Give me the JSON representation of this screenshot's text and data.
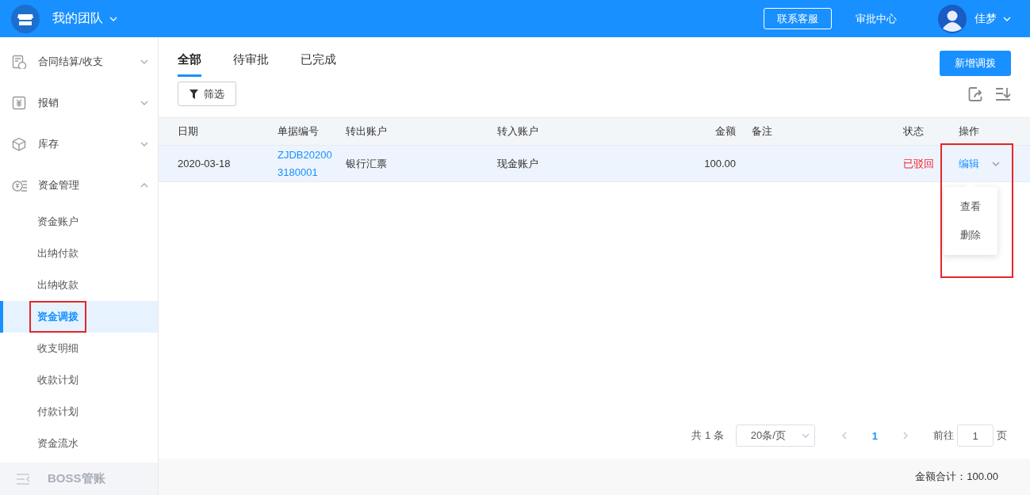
{
  "header": {
    "team": "我的团队",
    "service_button": "联系客服",
    "approval_link": "审批中心",
    "user": "佳梦"
  },
  "sidebar": {
    "items": [
      {
        "label": "合同结算/收支",
        "expanded": false
      },
      {
        "label": "报销",
        "expanded": false
      },
      {
        "label": "库存",
        "expanded": false
      },
      {
        "label": "资金管理",
        "expanded": true,
        "children": [
          {
            "label": "资金账户",
            "selected": false,
            "highlighted": false
          },
          {
            "label": "出纳付款",
            "selected": false,
            "highlighted": false
          },
          {
            "label": "出纳收款",
            "selected": false,
            "highlighted": false
          },
          {
            "label": "资金调拨",
            "selected": true,
            "highlighted": true
          },
          {
            "label": "收支明细",
            "selected": false,
            "highlighted": false
          },
          {
            "label": "收款计划",
            "selected": false,
            "highlighted": false
          },
          {
            "label": "付款计划",
            "selected": false,
            "highlighted": false
          },
          {
            "label": "资金流水",
            "selected": false,
            "highlighted": false
          }
        ]
      }
    ],
    "footer": "BOSS管账"
  },
  "tabs": [
    {
      "label": "全部",
      "selected": true
    },
    {
      "label": "待审批",
      "selected": false
    },
    {
      "label": "已完成",
      "selected": false
    }
  ],
  "add_button": "新增调拨",
  "filter_button": "筛选",
  "table": {
    "columns": [
      "日期",
      "单据编号",
      "转出账户",
      "转入账户",
      "金额",
      "备注",
      "状态",
      "操作"
    ],
    "rows": [
      {
        "date": "2020-03-18",
        "number": "ZJDB202003180001",
        "from": "银行汇票",
        "to": "现金账户",
        "amount": "100.00",
        "status": {
          "label": "已驳回",
          "color": "#f5222d"
        },
        "selected": true,
        "action": "编辑",
        "menu_open": true,
        "highlighted": true,
        "menu": [
          "查看",
          "删除"
        ]
      }
    ]
  },
  "pagination": {
    "total": "共 1 条",
    "page_size": "20条/页",
    "pages": [
      {
        "label": "1",
        "selected": true
      }
    ],
    "goto_label": "前往",
    "goto_value": "1",
    "goto_suffix": "页"
  },
  "summary": "金额合计：100.00"
}
